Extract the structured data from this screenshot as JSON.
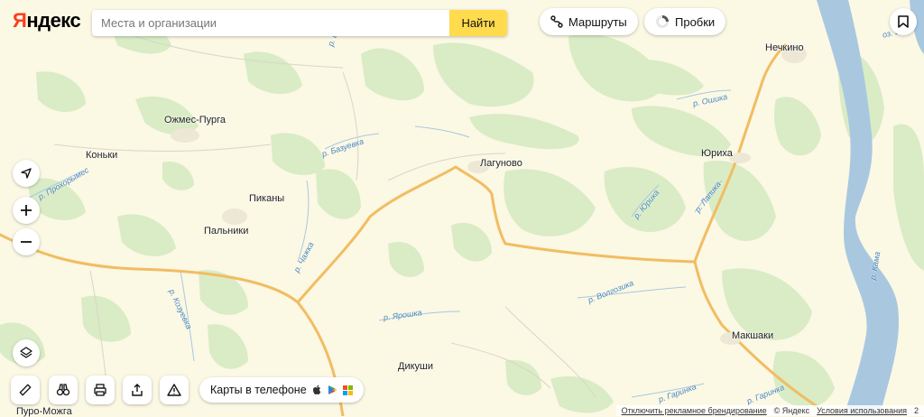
{
  "logo": {
    "first_letter": "Я",
    "rest": "ндекс"
  },
  "search": {
    "placeholder": "Места и организации",
    "button_label": "Найти"
  },
  "top_controls": {
    "routes_label": "Маршруты",
    "traffic_label": "Пробки"
  },
  "phone_promo": {
    "label": "Карты в телефоне"
  },
  "places": {
    "nechkino": "Нечкино",
    "ozhmes_purga": "Ожмес-Пурга",
    "konki": "Коньки",
    "lagunovo": "Лагуново",
    "yuriha": "Юриха",
    "pikany": "Пиканы",
    "palniki": "Пальники",
    "makshaki": "Макшаки",
    "dikushi": "Дикуши",
    "puro_mozhga": "Пуро-Можга"
  },
  "rivers": {
    "bazuevka": "р. Базуевка",
    "oshika": "р. Ошика",
    "yurika": "р. Юрика",
    "lapika": "р. Лапика",
    "prohorovka": "р. Прохорымес",
    "chazhka": "р. Чажка",
    "kozyuevka": "р. Козуевка",
    "yaroshka": "р. Ярошка",
    "volgozhka": "р. Волгозика",
    "garinka1": "р. Гаринка",
    "garinka2": "р. Гаринка",
    "kama": "р. Кама",
    "top_clipped": "р. Ба",
    "ozero": "оз. Бо"
  },
  "footer": {
    "ad_text": "Отключить рекламное брендирование",
    "copyright": "© Яндекс",
    "terms": "Условия использования",
    "scale": "2"
  },
  "colors": {
    "accent": "#ffdb4d",
    "logo_red": "#fc3f1d",
    "forest": "#d9ecc5",
    "land": "#fbf8e4",
    "road": "#f1bd62",
    "water": "#a9c8e0"
  }
}
